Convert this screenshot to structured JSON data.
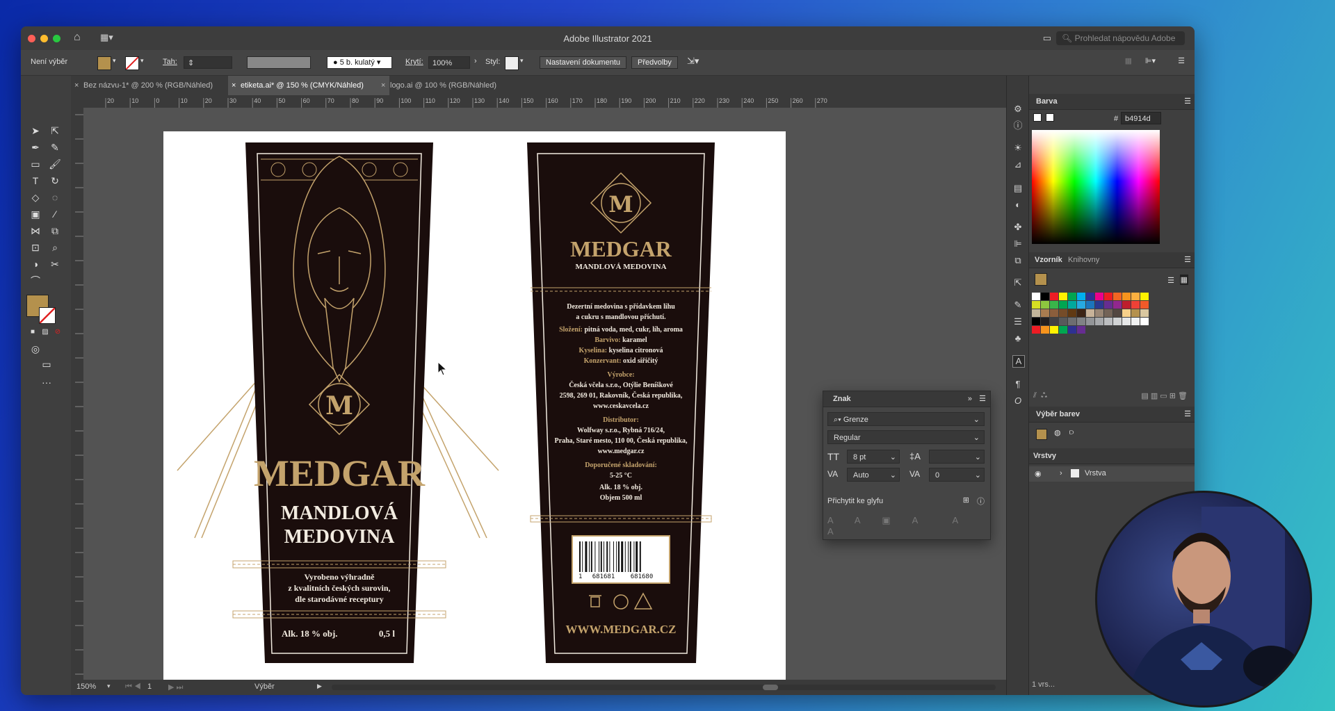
{
  "window": {
    "title": "Adobe Illustrator 2021",
    "help_placeholder": "Prohledat nápovědu Adobe"
  },
  "control_bar": {
    "selection": "Není výběr",
    "stroke_label": "Tah:",
    "brush": "5 b. kulatý",
    "opacity_label": "Krytí:",
    "opacity_value": "100%",
    "style_label": "Styl:",
    "doc_setup": "Nastavení dokumentu",
    "preferences": "Předvolby"
  },
  "tabs": [
    {
      "label": "Bez názvu-1* @ 200 % (RGB/Náhled)"
    },
    {
      "label": "etiketa.ai* @ 150 % (CMYK/Náhled)"
    },
    {
      "label": "logo.ai @ 100 % (RGB/Náhled)"
    }
  ],
  "ruler_ticks": [
    "20",
    "10",
    "0",
    "10",
    "20",
    "30",
    "40",
    "50",
    "60",
    "70",
    "80",
    "90",
    "100",
    "110",
    "120",
    "130",
    "140",
    "150",
    "160",
    "170",
    "180",
    "190",
    "200",
    "210",
    "220",
    "230",
    "240",
    "250",
    "260",
    "270"
  ],
  "front_label": {
    "brand": "MEDGAR",
    "name_line1": "MANDLOVÁ",
    "name_line2": "MEDOVINA",
    "tagline1": "Vyrobeno výhradně",
    "tagline2": "z kvalitních českých surovin,",
    "tagline3": "dle starodávné receptury",
    "alcohol": "Alk. 18 % obj.",
    "volume": "0,5 l"
  },
  "back_label": {
    "brand": "MEDGAR",
    "subtitle": "MANDLOVÁ MEDOVINA",
    "desc1": "Dezertní medovina s přídavkem lihu",
    "desc2": "a cukru s mandlovou příchutí.",
    "comp_label": "Složení:",
    "comp_value": "pitná voda, med, cukr, líh, aroma",
    "color_label": "Barvivo:",
    "color_value": "karamel",
    "acid_label": "Kyselina:",
    "acid_value": "kyselina citronová",
    "cons_label": "Konzervant:",
    "cons_value": "oxid siřičitý",
    "maker_label": "Výrobce:",
    "maker1": "Česká včela s.r.o., Otýlie Beníškové",
    "maker2": "2598, 269 01, Rakovník, Česká republika,",
    "maker3": "www.ceskavcela.cz",
    "dist_label": "Distributor:",
    "dist1": "Wolfway s.r.o., Rybná 716/24,",
    "dist2": "Praha, Staré mesto, 110 00, Česká republika,",
    "dist3": "www.medgar.cz",
    "storage_label": "Doporučené skladování:",
    "storage_value": "5-25 °C",
    "alcohol": "Alk. 18 % obj.",
    "volume": "Objem 500 ml",
    "barcode_left": "1",
    "barcode_mid": "681681",
    "barcode_right": "681680",
    "website": "WWW.MEDGAR.CZ"
  },
  "status": {
    "zoom": "150%",
    "page": "1",
    "tool": "Výběr"
  },
  "panels": {
    "color_title": "Barva",
    "hex_label": "#",
    "hex_value": "b4914d",
    "swatches_tab": "Vzorník",
    "libraries_tab": "Knihovny",
    "color_pick_title": "Výběr barev",
    "layers_title": "Vrstvy",
    "layer_name": "Vrstva",
    "layers_count": "1 vrs..."
  },
  "char_panel": {
    "title": "Znak",
    "font": "Grenze",
    "style": "Regular",
    "size": "8 pt",
    "leading": "",
    "kerning": "Auto",
    "tracking": "0",
    "snap": "Přichytit ke glyfu"
  },
  "colors": {
    "accent_gold": "#c4a36c",
    "label_bg": "#1a0d0c",
    "fill_swatch": "#b4914d"
  }
}
